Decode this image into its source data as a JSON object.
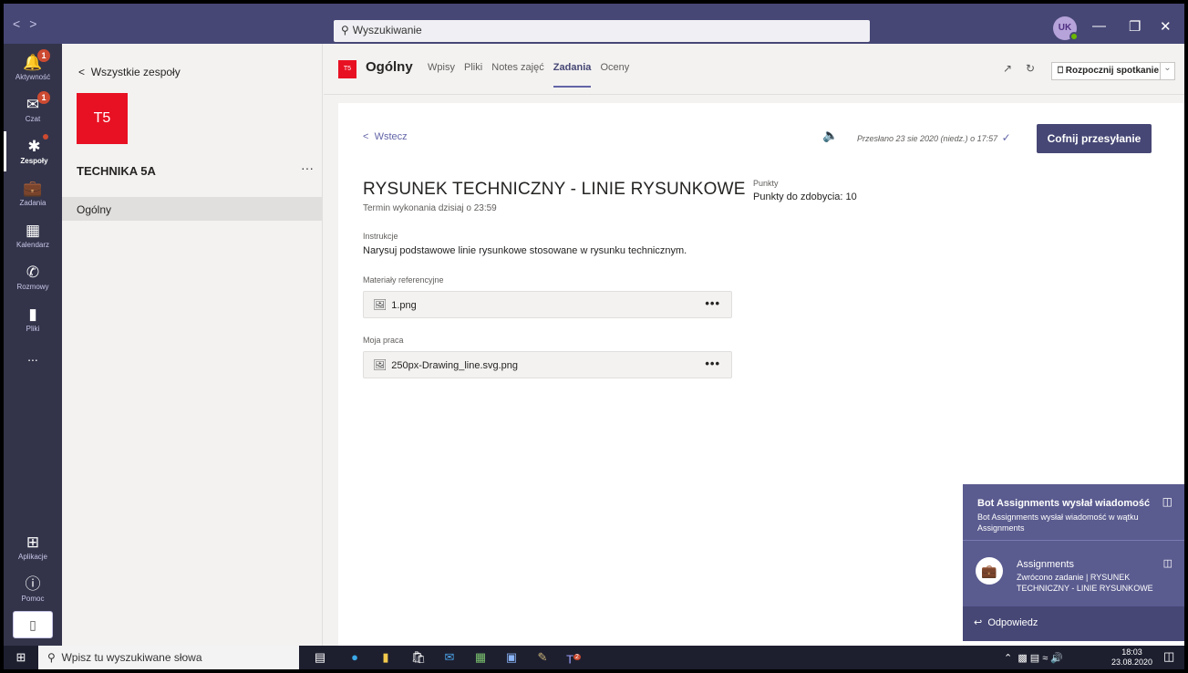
{
  "window": {
    "nav_back": "<",
    "nav_fwd": ">",
    "search_placeholder": "Wyszukiwanie",
    "avatar_initials": "UK",
    "minimize": "—",
    "restore": "❐",
    "close": "✕"
  },
  "rail": {
    "items": [
      {
        "label": "Aktywność",
        "icon": "bell-icon",
        "badge": "1"
      },
      {
        "label": "Czat",
        "icon": "chat-icon",
        "badge": "1"
      },
      {
        "label": "Zespoły",
        "icon": "teams-icon",
        "badge": ""
      },
      {
        "label": "Zadania",
        "icon": "assignments-icon",
        "badge": ""
      },
      {
        "label": "Kalendarz",
        "icon": "calendar-icon",
        "badge": ""
      },
      {
        "label": "Rozmowy",
        "icon": "phone-icon",
        "badge": ""
      },
      {
        "label": "Pliki",
        "icon": "files-icon",
        "badge": ""
      },
      {
        "label": "...",
        "icon": "more-icon",
        "badge": ""
      }
    ],
    "apps_label": "Aplikacje",
    "help_label": "Pomoc"
  },
  "team": {
    "back_label": "Wszystkie zespoły",
    "tile": "T5",
    "name": "TECHNIKA 5A",
    "more": "···",
    "channels": [
      "Ogólny"
    ]
  },
  "channel_header": {
    "tile": "T5",
    "title": "Ogólny",
    "tabs": [
      "Wpisy",
      "Pliki",
      "Notes zajęć",
      "Zadania",
      "Oceny"
    ],
    "active_tab": "Zadania",
    "meet_button": "Rozpocznij spotkanie"
  },
  "assignment": {
    "back_label": "Wstecz",
    "submitted_text": "Przesłano 23 sie 2020 (niedz.) o 17:57",
    "undo_button": "Cofnij przesyłanie",
    "title": "RYSUNEK TECHNICZNY - LINIE RYSUNKOWE",
    "due": "Termin wykonania dzisiaj o 23:59",
    "points_label": "Punkty",
    "points_value": "Punkty do zdobycia: 10",
    "instructions_label": "Instrukcje",
    "instructions": "Narysuj podstawowe linie rysunkowe stosowane w rysunku technicznym.",
    "reference_label": "Materiały referencyjne",
    "reference_file": "1.png",
    "mywork_label": "Moja praca",
    "mywork_file": "250px-Drawing_line.svg.png",
    "file_more": "•••"
  },
  "notification": {
    "title": "Bot Assignments wysłał wiadomość",
    "subtitle": "Bot Assignments wysłał wiadomość w wątku Assignments",
    "sender": "Assignments",
    "message": "Zwrócono zadanie | RYSUNEK TECHNICZNY - LINIE RYSUNKOWE",
    "reply": "Odpowiedz"
  },
  "taskbar": {
    "search_placeholder": "Wpisz tu wyszukiwane słowa",
    "teams_badge": "2",
    "time": "18:03",
    "date": "23.08.2020"
  }
}
